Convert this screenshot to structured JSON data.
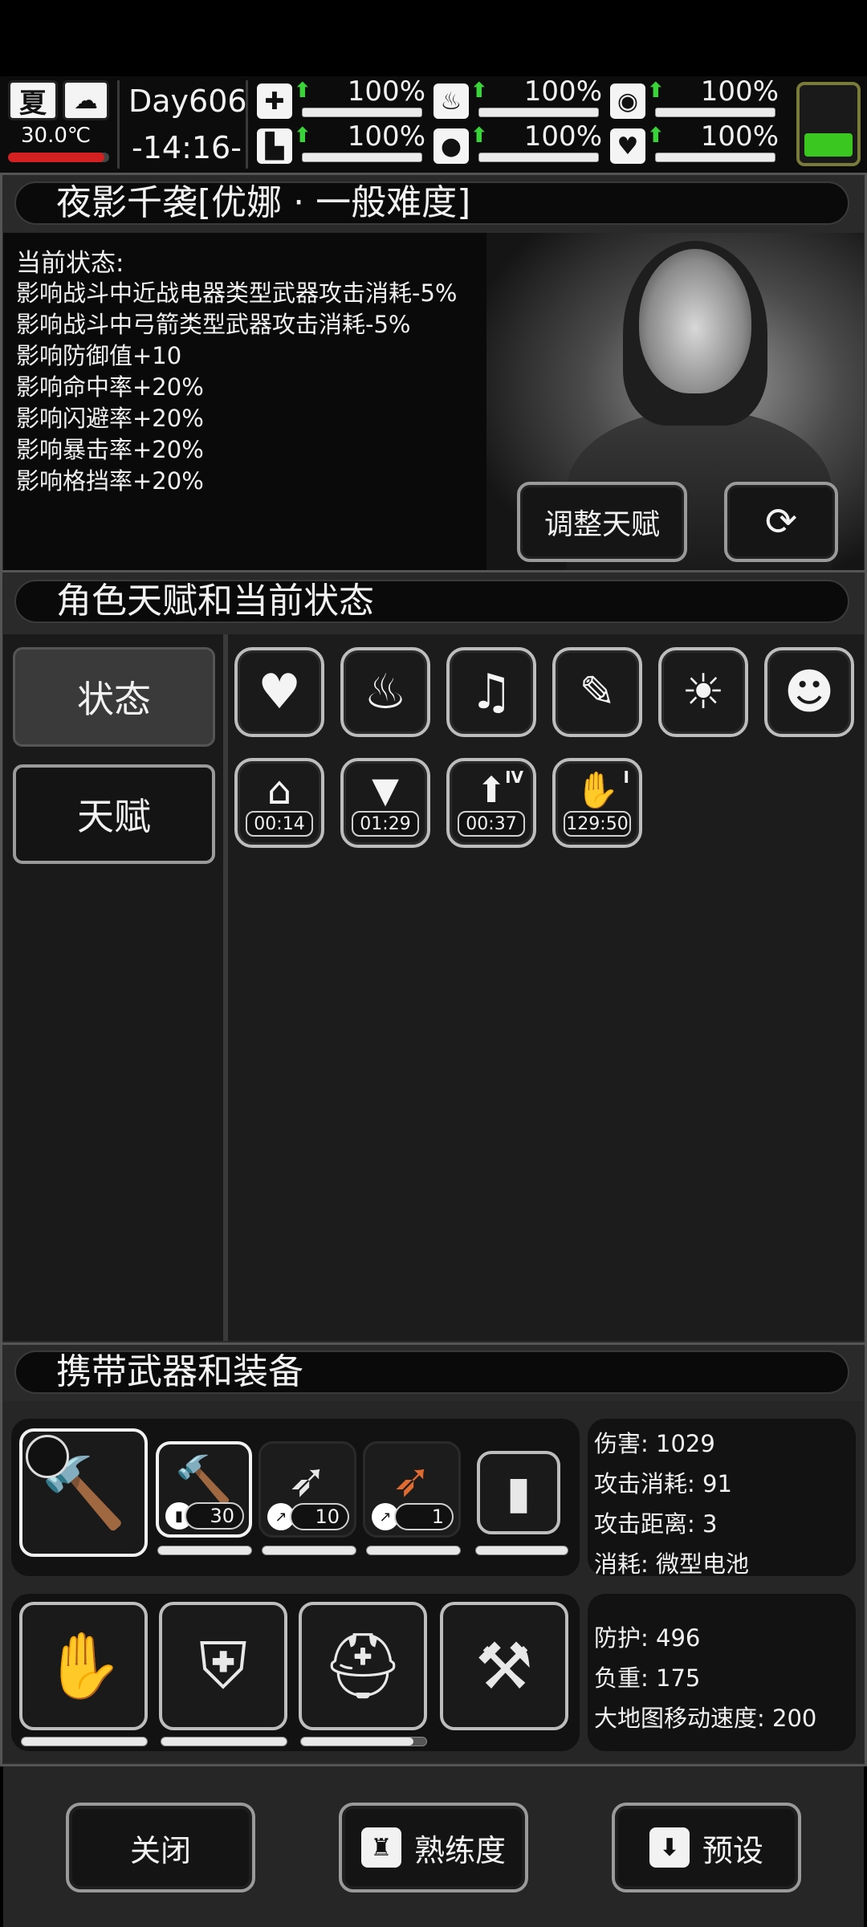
{
  "statusbar": {
    "season": "夏",
    "weather_icon": "cloud-rain-icon",
    "temperature": "30.0℃",
    "temperature_level": 0.95,
    "day": "Day606",
    "time": "-14:16-",
    "stats": [
      {
        "icon": "medkit-icon",
        "glyph": "✚",
        "value": "100%",
        "trend": "up"
      },
      {
        "icon": "stomach-icon",
        "glyph": "♨",
        "value": "100%",
        "trend": "up"
      },
      {
        "icon": "stamina-icon",
        "glyph": "◉",
        "value": "100%",
        "trend": "up"
      },
      {
        "icon": "boot-icon",
        "glyph": "▙",
        "value": "100%",
        "trend": "up"
      },
      {
        "icon": "water-drop-icon",
        "glyph": "💧",
        "value": "100%",
        "trend": "up"
      },
      {
        "icon": "heart-icon",
        "glyph": "♥",
        "value": "100%",
        "trend": "up"
      }
    ],
    "battery_level": 0.3
  },
  "character": {
    "title": "夜影千袭[优娜 · 一般难度]",
    "state_heading": "当前状态:",
    "state_lines": [
      "影响战斗中近战电器类型武器攻击消耗-5%",
      "影响战斗中弓箭类型武器攻击消耗-5%",
      "影响防御值+10",
      "影响命中率+20%",
      "影响闪避率+20%",
      "影响暴击率+20%",
      "影响格挡率+20%"
    ],
    "adjust_talent_label": "调整天赋",
    "outfit_icon": "change-outfit-icon"
  },
  "talents": {
    "title": "角色天赋和当前状态",
    "tabs": [
      {
        "label": "状态",
        "active": true
      },
      {
        "label": "天赋",
        "active": false
      }
    ],
    "effects": [
      {
        "icon": "heart-full-icon",
        "glyph": "♥"
      },
      {
        "icon": "stomach-arrows-icon",
        "glyph": "♨"
      },
      {
        "icon": "music-heart-icon",
        "glyph": "♫"
      },
      {
        "icon": "clipboard-bandage-icon",
        "glyph": "📋"
      },
      {
        "icon": "alarm-light-icon",
        "glyph": "☀"
      },
      {
        "icon": "person-no-smoking-icon",
        "glyph": "☻"
      },
      {
        "icon": "shelter-question-icon",
        "glyph": "⌂",
        "timer": "00:14"
      },
      {
        "icon": "clean-shirt-icon",
        "glyph": "👕",
        "timer": "01:29"
      },
      {
        "icon": "drink-boost-icon",
        "glyph": "⬆",
        "timer": "00:37",
        "level": "IV"
      },
      {
        "icon": "bandaged-arm-icon",
        "glyph": "✋",
        "timer": "129:50",
        "level": "I"
      }
    ]
  },
  "equipment": {
    "title": "携带武器和装备",
    "weapons": [
      {
        "icon": "electric-hammer-icon",
        "glyph": "🔨",
        "count": "",
        "durability": 1.0
      },
      {
        "icon": "electric-hammer-icon",
        "glyph": "🔨",
        "count": "30",
        "durability": 1.0
      },
      {
        "icon": "spear-icon",
        "glyph": "➶",
        "count": "10",
        "durability": 1.0
      },
      {
        "icon": "torch-spear-icon",
        "glyph": "➶",
        "count": "1",
        "durability": 1.0
      },
      {
        "icon": "battery-cell-icon",
        "glyph": "▮",
        "count": "",
        "durability": 1.0
      }
    ],
    "weapon_stats": [
      "伤害: 1029",
      "攻击消耗: 91",
      "攻击距离: 3",
      "消耗: 微型电池"
    ],
    "armor": [
      {
        "icon": "gloves-icon",
        "glyph": "✋",
        "durability": 1.0
      },
      {
        "icon": "body-armor-icon",
        "glyph": "⛨",
        "durability": 1.0
      },
      {
        "icon": "helmet-icon",
        "glyph": "⛑",
        "durability": 0.9
      },
      {
        "icon": "backpack-frame-icon",
        "glyph": "⚒",
        "durability": null
      }
    ],
    "armor_stats": [
      "防护: 496",
      "负重: 175",
      "大地图移动速度: 200"
    ]
  },
  "bottom": {
    "close_label": "关闭",
    "proficiency_label": "熟练度",
    "preset_label": "预设"
  }
}
